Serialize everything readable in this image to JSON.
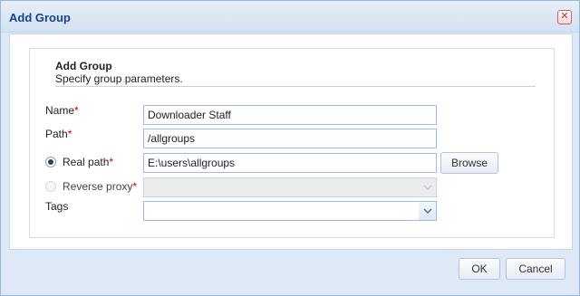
{
  "dialog": {
    "title": "Add Group",
    "close_glyph": "✕"
  },
  "form": {
    "section_title": "Add Group",
    "section_desc": "Specify group parameters.",
    "name": {
      "label": "Name",
      "req": "*",
      "value": "Downloader Staff"
    },
    "path": {
      "label": "Path",
      "req": "*",
      "value": "/allgroups"
    },
    "real_path": {
      "label": "Real path",
      "req": "*",
      "value": "E:\\users\\allgroups",
      "selected": true
    },
    "browse_label": "Browse",
    "reverse_proxy": {
      "label": "Reverse proxy",
      "req": "*",
      "value": "",
      "selected": false
    },
    "tags": {
      "label": "Tags",
      "value": ""
    }
  },
  "footer": {
    "ok_label": "OK",
    "cancel_label": "Cancel"
  },
  "icons": {
    "dropdown": "chevron-down-icon",
    "close": "close-icon"
  }
}
